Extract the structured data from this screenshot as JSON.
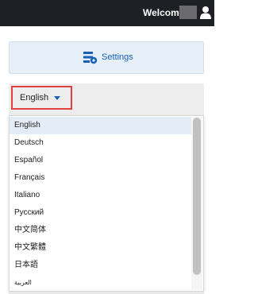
{
  "header": {
    "welcome_label": "Welcome",
    "icons": [
      "user-icon"
    ]
  },
  "settings": {
    "label": "Settings",
    "icon": "settings-icon",
    "accent": "#1a61b5"
  },
  "language": {
    "selected": "English",
    "options": [
      "English",
      "Deutsch",
      "Español",
      "Français",
      "Italiano",
      "Русский",
      "中文简体",
      "中文繁體",
      "日本語",
      "العربية"
    ],
    "highlight_color": "#e04040"
  }
}
